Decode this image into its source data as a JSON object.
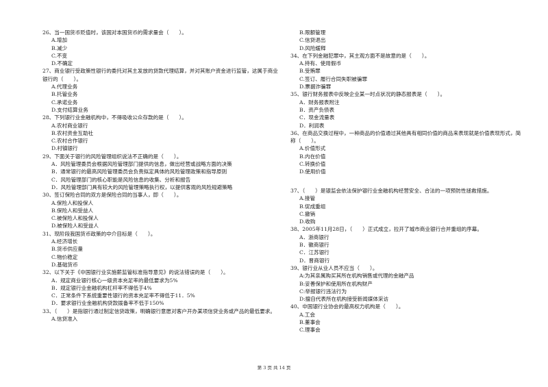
{
  "left_column": {
    "questions": [
      {
        "stem": "26、当一国货币贬值时，该国对本国货币的需求量会（　　）。",
        "options": [
          "A.增加",
          "B.减少",
          "C.不变",
          "D.不确定"
        ]
      },
      {
        "stem": "27、商业银行受政策性银行的委托对其主发放的贷款代理结算，并对其账户资金进行监管，这属于商业银行的（　　）。",
        "options": [
          "A.代理业务",
          "B.托管业务",
          "C.承诺业务",
          "D.支付结算业务"
        ]
      },
      {
        "stem": "28、下列银行业金融机构中，不得吸收公众存款的是（　　）。",
        "options": [
          "A.农村商业银行",
          "B.农村资金互助社",
          "C.农村合作银行",
          "D.村镇银行"
        ]
      },
      {
        "stem": "29、下面关于银行的风险管理组织说法不正确的是（　　）。",
        "options": [
          "A．风险管理委员会根据风险管理部门提供的信息，做出经营或战略方面的决策",
          "B．通常银行的最高风险管理委员会负责拟定具体的风险管理政策和指导原则",
          "C．风险管理部门的核心职能是风险信息的收集、分析和报告",
          "D．风险管理部门具有较大的风险管理策略执行权，以提供客观的风险规避策略"
        ]
      },
      {
        "stem": "30、签订保险合同的双方是保险合同的当事人，即（　　）。",
        "options": [
          "A.保险人和投保人",
          "B.保险人和受益人",
          "C.被保险人和投保人",
          "D.被保险人和受益人"
        ]
      },
      {
        "stem": "31、现阶段我国货币政策的中介目标是（　　）。",
        "options": [
          "A.经济增长",
          "B.货币供应量",
          "C.物价稳定",
          "D.基础货币"
        ]
      },
      {
        "stem": "32、以下关于《中国银行业实施薪监管标准指导意见》的说法错误的是（　　）。",
        "options": [
          "A．规定商业银行核心一级资本充足率的最低要求为5%",
          "B．规定银行业金融机构杠杆率不得低于4%",
          "C．正常条件下系统重要性银行的资本充足率不得低于11．5%",
          "D．要求银行业金融机构贷款拨备率不低于150%"
        ]
      },
      {
        "stem": "33、（　　）是指银行通过制定信贷政策，明确银行意愿对客户开办某项信贷业务或产品的最低要求。",
        "options": [
          "A.信贷准入"
        ]
      }
    ]
  },
  "right_column": {
    "continued_options": [
      "B.限额管理",
      "C.信贷退出",
      "D.风险缓释"
    ],
    "questions": [
      {
        "stem": "34、在下列金融犯罪中，其主观方面不是故意的是（　　）。",
        "options": [
          "A.持有、使用假币",
          "B.受贿罪",
          "C.签订、履行合同失职被骗罪",
          "D.票据诈骗罪"
        ]
      },
      {
        "stem": "35、银行财务报表中反映企业某一时点状况的静态报表是（　　）。",
        "options": [
          "A．财务报表附注",
          "B．资产负债表",
          "C．现金流量表",
          "D．利润表"
        ]
      },
      {
        "stem": "36、在商品交换过程中，一种商品的价值通过其他具有相同价值的商品来表现就是价值表现形式，简称（　　）。",
        "options": [
          "A.价值形式",
          "B.内在价值",
          "C.转换价值",
          "D.使用价值"
        ]
      },
      {
        "stem": "37、（　　）是银监会依法保护银行业金融机构经营安全、合法的一项预防性拯救措施。",
        "options": [
          "A.接管",
          "B.促成重组",
          "C.撤销",
          "D.收购"
        ]
      },
      {
        "stem": "38、2005年11月28日，（　　）正式成立，拉开了城市商业银行合并重组的序幕。",
        "options": [
          "A．浙商银行",
          "B．徽商银行",
          "C．江苏银行",
          "D．晋商银行"
        ]
      },
      {
        "stem": "39、银行业从业人员不应当（　　）。",
        "options": [
          "A:为其亲属购买其所在机构销售或代理的金融产品",
          "B:妥善保护和使用所在机构财产",
          "C:举报银行违法行为",
          "D:擅自代表所在机构接受新闻媒体采访"
        ]
      },
      {
        "stem": "40、中国银行业协会的最高权力机构是（　　）。",
        "options": [
          "A.工会",
          "B.董事会",
          "C.理事会"
        ]
      }
    ]
  },
  "footer": {
    "page_label": "第 3 页 共 14 页"
  }
}
